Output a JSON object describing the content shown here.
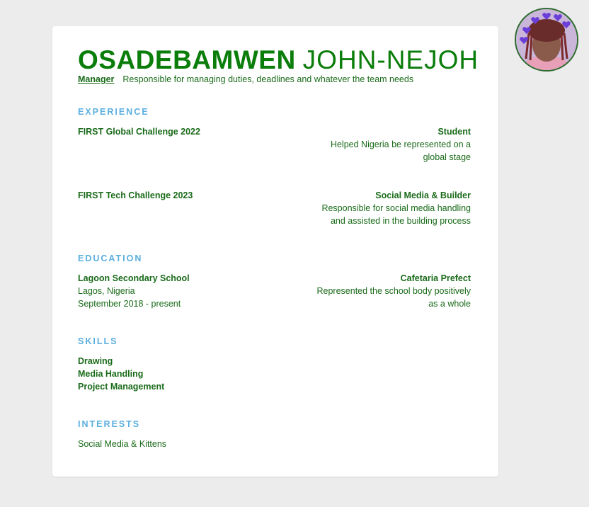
{
  "colors": {
    "page_background": "#ececec",
    "card_background": "#ffffff",
    "name_green": "#0a7d0a",
    "text_green": "#1a6b1a",
    "section_blue": "#5aafe0"
  },
  "header": {
    "first_name": "OSADEBAMWEN",
    "last_name": "JOHN-NEJOH",
    "role": "Manager",
    "role_description": "Responsible for managing duties, deadlines and whatever the team needs"
  },
  "experience": {
    "title": "EXPERIENCE",
    "entries": [
      {
        "org": "FIRST Global Challenge 2022",
        "position": "Student",
        "details": [
          "Helped Nigeria be represented on a",
          "global stage"
        ]
      },
      {
        "org": "FIRST Tech Challenge 2023",
        "position": "Social Media & Builder",
        "details": [
          "Responsible for social media handling",
          "and assisted in the building process"
        ]
      }
    ]
  },
  "education": {
    "title": "EDUCATION",
    "school": "Lagoon Secondary School",
    "location": "Lagos, Nigeria",
    "dates": "September 2018 - present",
    "position": "Cafetaria Prefect",
    "details": [
      "Represented the school body positively",
      "as a whole"
    ]
  },
  "skills": {
    "title": "SKILLS",
    "items": [
      "Drawing",
      "Media Handling",
      "Project Management"
    ]
  },
  "interests": {
    "title": "INTERESTS",
    "text": "Social Media & Kittens"
  },
  "avatar": {
    "icon": "profile-photo-with-hearts-icon"
  }
}
